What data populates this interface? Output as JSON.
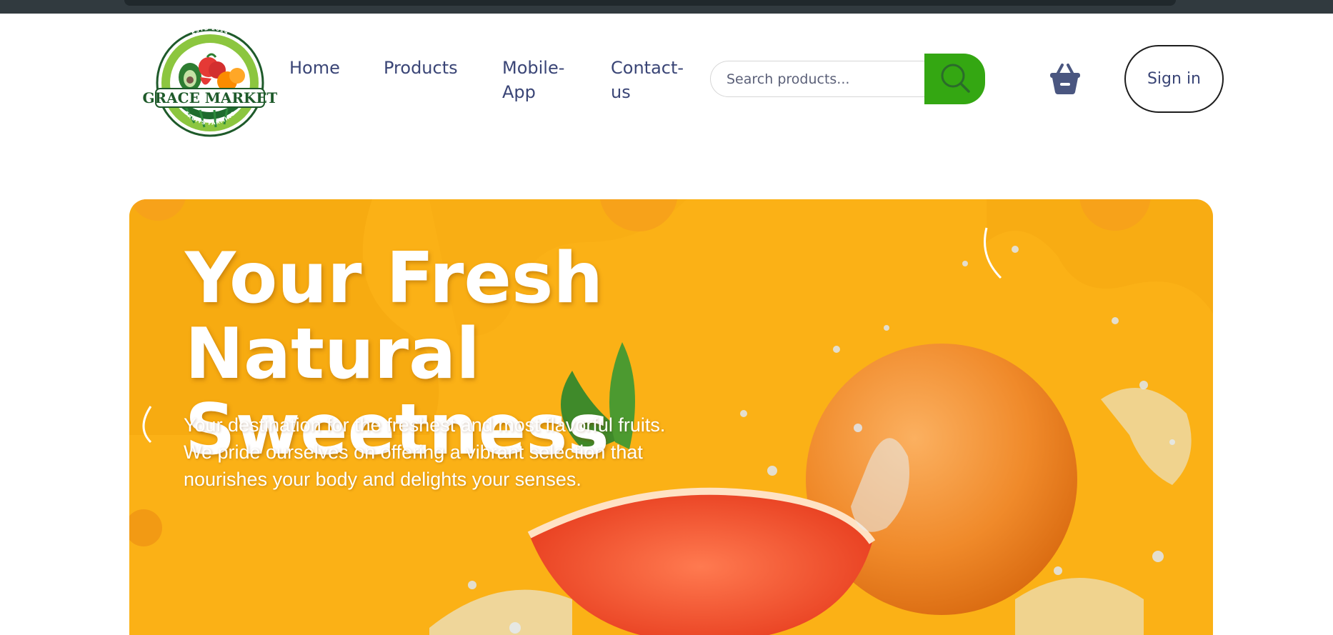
{
  "brand": {
    "name": "GRACE MARKET",
    "top_text": "ESTD 2024",
    "bottom_text": "FRUITS FARMING"
  },
  "nav": {
    "items": [
      {
        "label": "Home"
      },
      {
        "label": "Products"
      },
      {
        "label": "Mobile-App"
      },
      {
        "label": "Contact-us"
      }
    ]
  },
  "search": {
    "placeholder": "Search products...",
    "value": "",
    "icon": "search-icon"
  },
  "cart": {
    "icon": "shopping-basket-icon"
  },
  "auth": {
    "signin_label": "Sign in"
  },
  "hero": {
    "title_line1": "Your Fresh Natural",
    "title_line2": "Sweetness",
    "subtitle": "Your destination for the freshest and most flavorful fruits. We pride ourselves on offering a vibrant selection that nourishes your body and delights your senses."
  },
  "colors": {
    "accent_green": "#34a712",
    "nav_text": "#3a4576",
    "hero_bg": "#fbb116",
    "topbar": "#313a3f"
  }
}
